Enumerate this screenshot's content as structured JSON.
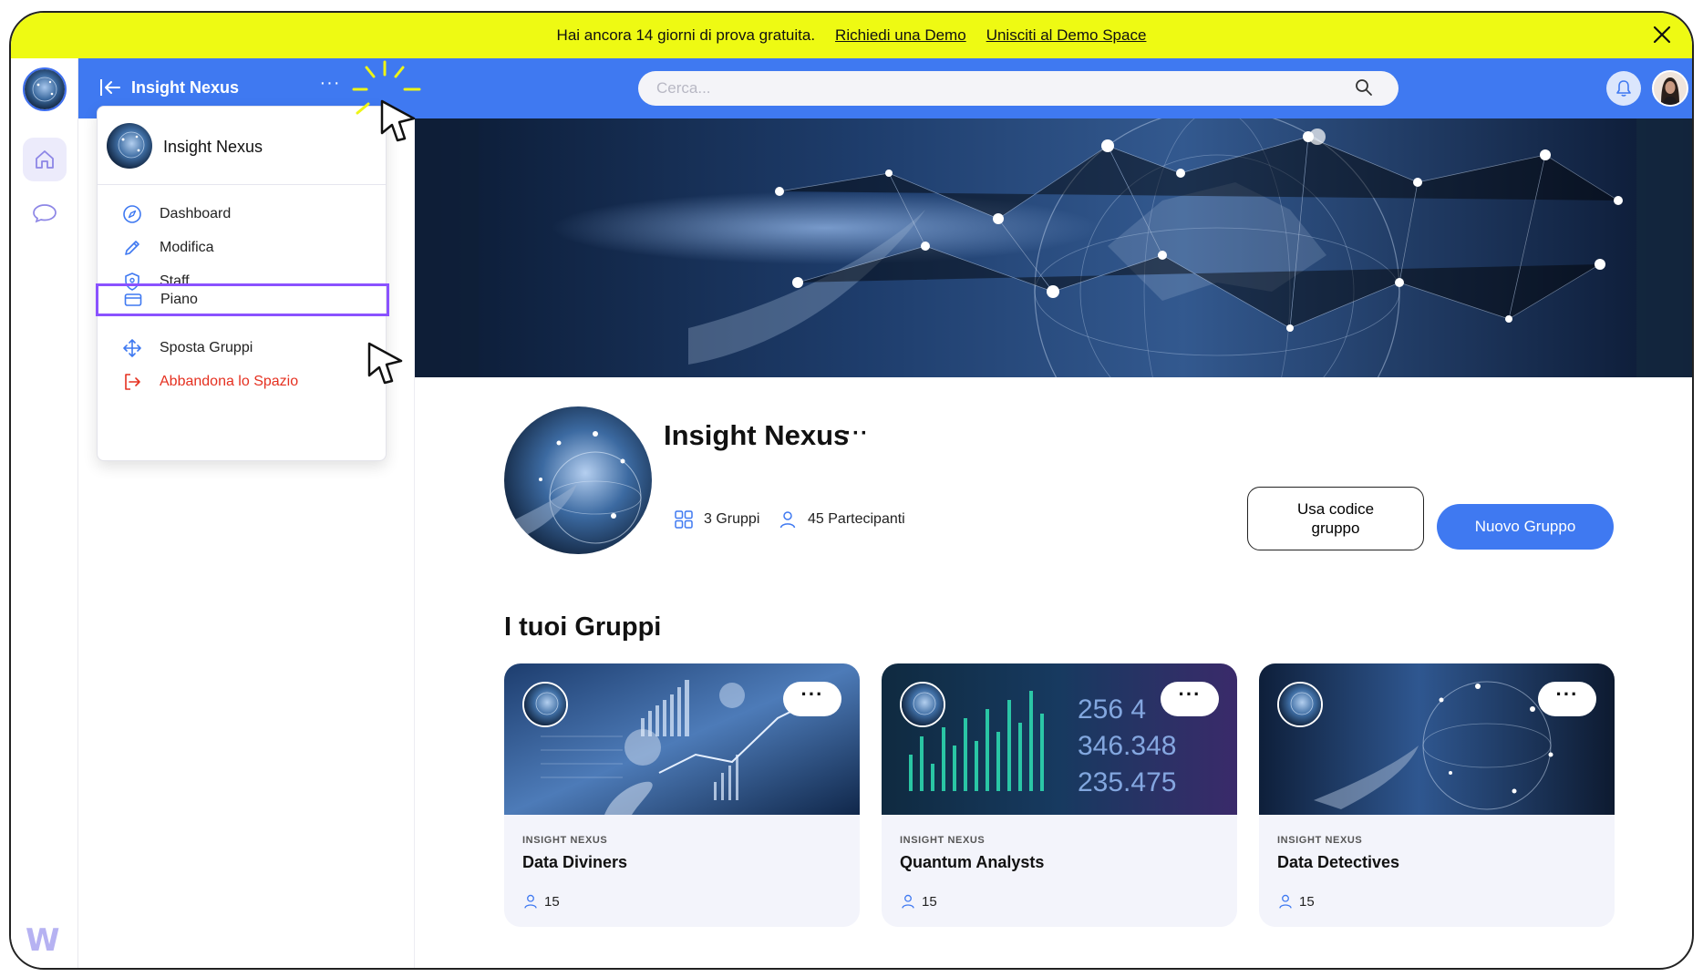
{
  "trial_banner": {
    "message": "Hai ancora 14 giorni di prova gratuita.",
    "demo_link": "Richiedi una Demo",
    "join_link": "Unisciti al Demo Space"
  },
  "header": {
    "space_title": "Insight Nexus",
    "more_label": "···",
    "search_placeholder": "Cerca..."
  },
  "space_menu": {
    "title": "Insight Nexus",
    "items": [
      {
        "label": "Dashboard",
        "icon": "compass-icon"
      },
      {
        "label": "Modifica",
        "icon": "pencil-icon"
      },
      {
        "label": "Staff",
        "icon": "shield-icon"
      },
      {
        "label": "Piano",
        "icon": "credit-card-icon",
        "selected": true
      },
      {
        "label": "Sposta Gruppi",
        "icon": "move-arrows-icon"
      },
      {
        "label": "Abbandona lo Spazio",
        "icon": "exit-icon",
        "danger": true
      }
    ]
  },
  "space": {
    "name": "Insight Nexus",
    "more_label": "···",
    "groups_stat": "3 Gruppi",
    "participants_stat": "45 Partecipanti",
    "use_code_button": "Usa codice gruppo",
    "new_group_button": "Nuovo Gruppo"
  },
  "groups_section": {
    "title": "I tuoi Gruppi",
    "cards": [
      {
        "org": "INSIGHT NEXUS",
        "name": "Data Diviners",
        "members": "15",
        "more": "···"
      },
      {
        "org": "INSIGHT NEXUS",
        "name": "Quantum Analysts",
        "members": "15",
        "more": "···"
      },
      {
        "org": "INSIGHT NEXUS",
        "name": "Data Detectives",
        "members": "15",
        "more": "···"
      }
    ]
  },
  "colors": {
    "banner": "#eefa13",
    "primary": "#3f79f1",
    "selection": "#8a52ff",
    "danger": "#e53020"
  }
}
